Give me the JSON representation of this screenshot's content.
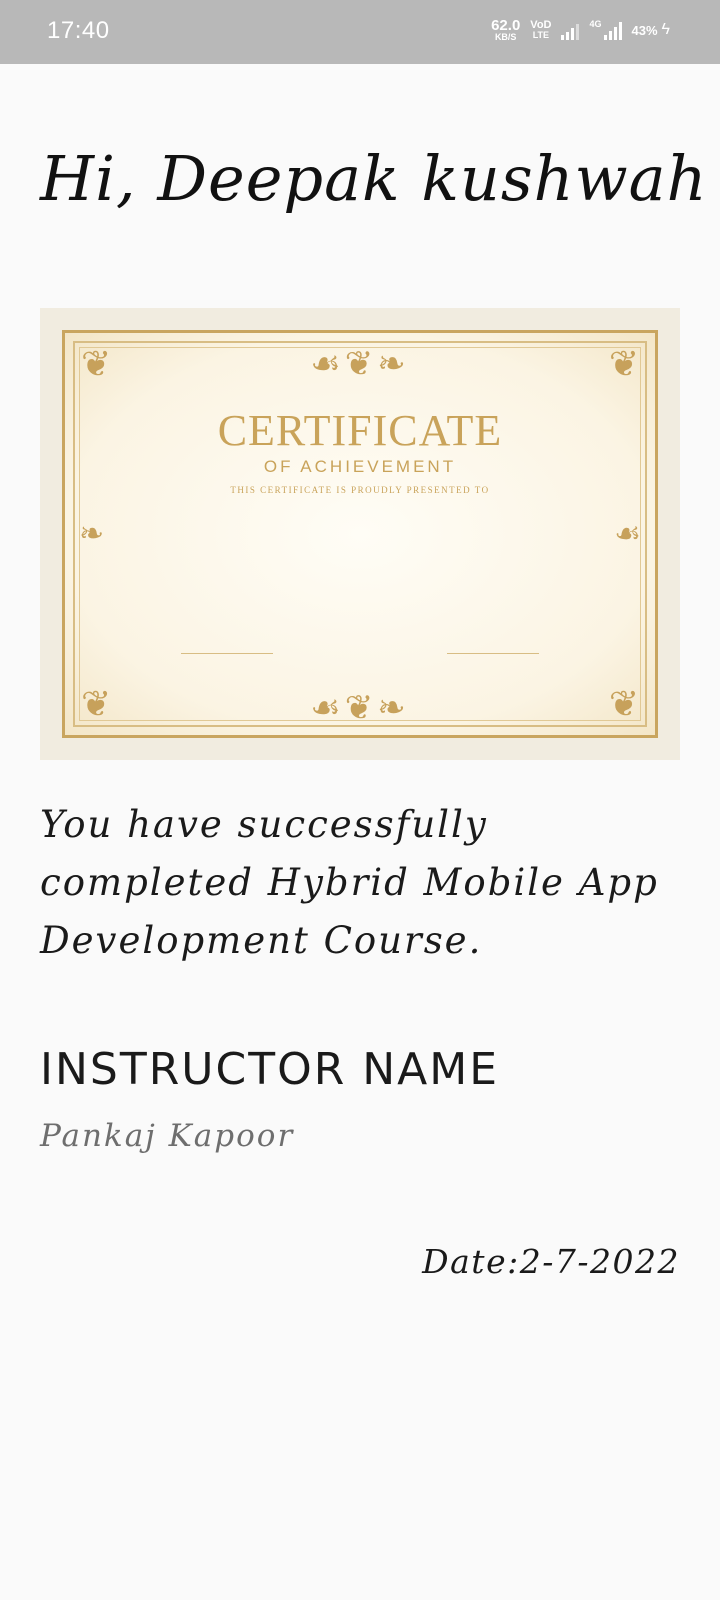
{
  "status_bar": {
    "time": "17:40",
    "net_speed": "62.0",
    "net_unit": "KB/S",
    "volte_top": "VoD",
    "volte_bottom": "LTE",
    "network_type": "4G",
    "battery": "43%",
    "charging_icon": "bolt-icon"
  },
  "greeting": "Hi, Deepak kushwah",
  "certificate": {
    "title": "CERTIFICATE",
    "subtitle": "OF ACHIEVEMENT",
    "presented_line": "THIS CERTIFICATE IS PROUDLY PRESENTED TO"
  },
  "message": "You have successfully completed Hybrid Mobile App Development Course.",
  "instructor": {
    "label": "INSTRUCTOR NAME",
    "name": "Pankaj Kapoor"
  },
  "date": "Date:2-7-2022",
  "colors": {
    "status_bar": "#b8b8b8",
    "background": "#fafafa",
    "gold": "#c9a35a"
  }
}
